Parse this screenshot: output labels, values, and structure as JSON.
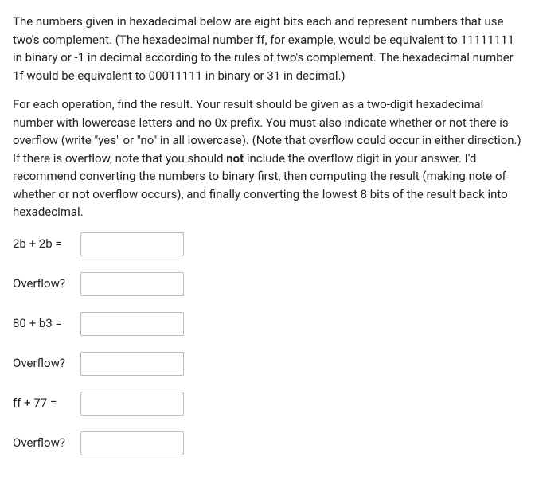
{
  "intro": {
    "p1_a": "The numbers given in hexadecimal below are eight bits each and represent numbers that use two's complement. (The hexadecimal number ff, for example, would be equivalent to 11111111 in binary or -1 in decimal according to the rules of two's complement. The hexadecimal number 1f would be equivalent to 00011111 in binary or 31 in decimal.)",
    "p2_a": "For each operation, find the result. Your result should be given as a two-digit hexadecimal number with lowercase letters and no 0x prefix. You must also indicate whether or not there is overflow (write \"yes\" or \"no\" in all lowercase). (Note that overflow could occur in either direction.) If there is overflow, note that you should ",
    "p2_bold": "not",
    "p2_b": " include the overflow digit in your answer. I'd recommend converting the numbers to binary first, then computing the result (making note of whether or not overflow occurs), and finally converting the lowest 8 bits of the result back into hexadecimal."
  },
  "rows": {
    "r1": {
      "label": "2b + 2b =",
      "value": ""
    },
    "r2": {
      "label": "Overflow?",
      "value": ""
    },
    "r3": {
      "label": "80 + b3 =",
      "value": ""
    },
    "r4": {
      "label": "Overflow?",
      "value": ""
    },
    "r5": {
      "label": "ff + 77 =",
      "value": ""
    },
    "r6": {
      "label": "Overflow?",
      "value": ""
    }
  }
}
